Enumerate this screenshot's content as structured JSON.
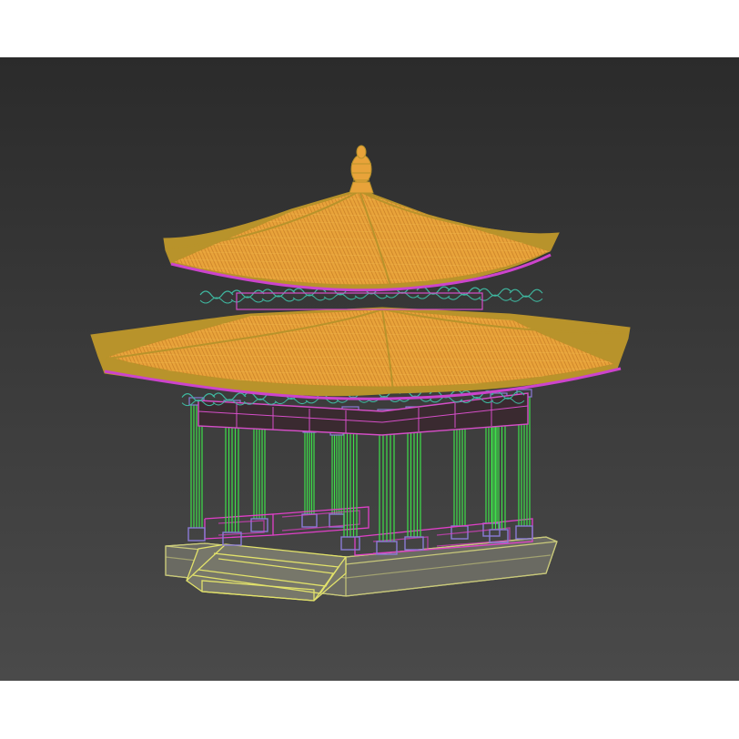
{
  "viewport": {
    "shading": "wireframe",
    "background_top": "#2b2b2b",
    "background_bottom": "#4a4a4a"
  },
  "model": {
    "subject": "pagoda-pavilion",
    "colors": {
      "roof": "#e8a33a",
      "roof_edge": "#b8932b",
      "bracket": "#3fb8a0",
      "fascia": "#cc44cc",
      "column": "#3ee04a",
      "column_base": "#8a7ad6",
      "beam": "#d64ec8",
      "railing": "#e040c8",
      "platform": "#c8c87a",
      "stairs": "#e2e26a",
      "platform_face": "#6a6a62",
      "finial": "#e8a33a"
    }
  }
}
